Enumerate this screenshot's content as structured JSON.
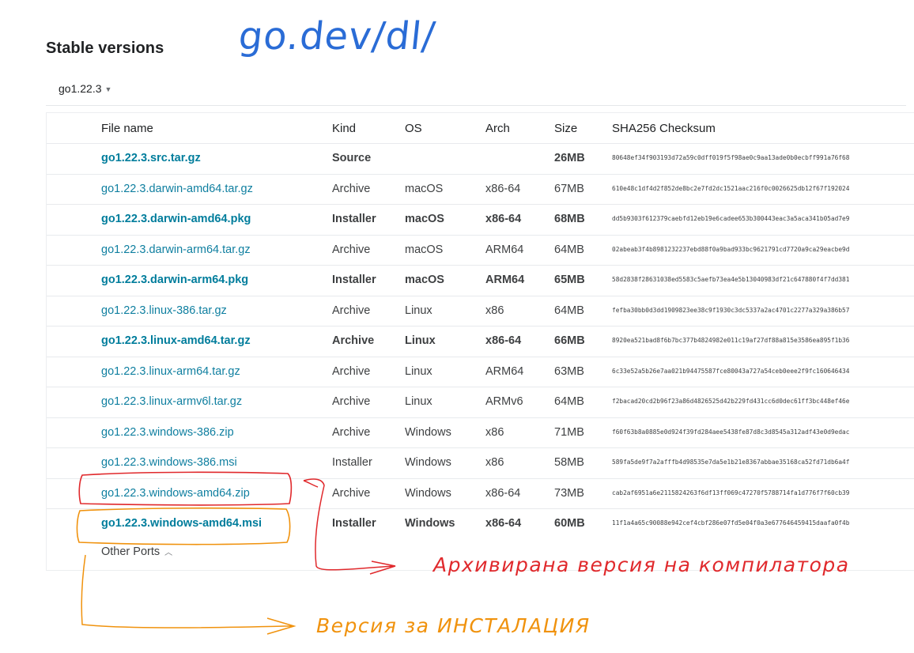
{
  "page": {
    "title": "Stable versions",
    "handwritten_url": "go.dev/dl/",
    "version_selected": "go1.22.3",
    "other_ports_label": "Other Ports"
  },
  "table": {
    "headers": {
      "file": "File name",
      "kind": "Kind",
      "os": "OS",
      "arch": "Arch",
      "size": "Size",
      "sha": "SHA256 Checksum"
    },
    "rows": [
      {
        "file": "go1.22.3.src.tar.gz",
        "kind": "Source",
        "os": "",
        "arch": "",
        "size": "26MB",
        "sha": "80648ef34f903193d72a59c0dff019f5f98ae0c9aa13ade0b0ecbff991a76f68",
        "bold": true
      },
      {
        "file": "go1.22.3.darwin-amd64.tar.gz",
        "kind": "Archive",
        "os": "macOS",
        "arch": "x86-64",
        "size": "67MB",
        "sha": "610e48c1df4d2f852de8bc2e7fd2dc1521aac216f0c0026625db12f67f192024",
        "bold": false
      },
      {
        "file": "go1.22.3.darwin-amd64.pkg",
        "kind": "Installer",
        "os": "macOS",
        "arch": "x86-64",
        "size": "68MB",
        "sha": "dd5b9303f612379caebfd12eb19e6cadee653b300443eac3a5aca341b05ad7e9",
        "bold": true
      },
      {
        "file": "go1.22.3.darwin-arm64.tar.gz",
        "kind": "Archive",
        "os": "macOS",
        "arch": "ARM64",
        "size": "64MB",
        "sha": "02abeab3f4b8981232237ebd88f0a9bad933bc9621791cd7720a9ca29eacbe9d",
        "bold": false
      },
      {
        "file": "go1.22.3.darwin-arm64.pkg",
        "kind": "Installer",
        "os": "macOS",
        "arch": "ARM64",
        "size": "65MB",
        "sha": "58d2838f28631038ed5583c5aefb73ea4e5b13040983df21c647880f4f7dd381",
        "bold": true
      },
      {
        "file": "go1.22.3.linux-386.tar.gz",
        "kind": "Archive",
        "os": "Linux",
        "arch": "x86",
        "size": "64MB",
        "sha": "fefba30bb0d3dd1909823ee38c9f1930c3dc5337a2ac4701c2277a329a386b57",
        "bold": false
      },
      {
        "file": "go1.22.3.linux-amd64.tar.gz",
        "kind": "Archive",
        "os": "Linux",
        "arch": "x86-64",
        "size": "66MB",
        "sha": "8920ea521bad8f6b7bc377b4824982e011c19af27df88a815e3586ea895f1b36",
        "bold": true
      },
      {
        "file": "go1.22.3.linux-arm64.tar.gz",
        "kind": "Archive",
        "os": "Linux",
        "arch": "ARM64",
        "size": "63MB",
        "sha": "6c33e52a5b26e7aa021b94475587fce80043a727a54ceb0eee2f9fc160646434",
        "bold": false
      },
      {
        "file": "go1.22.3.linux-armv6l.tar.gz",
        "kind": "Archive",
        "os": "Linux",
        "arch": "ARMv6",
        "size": "64MB",
        "sha": "f2bacad20cd2b96f23a86d4826525d42b229fd431cc6d0dec61ff3bc448ef46e",
        "bold": false
      },
      {
        "file": "go1.22.3.windows-386.zip",
        "kind": "Archive",
        "os": "Windows",
        "arch": "x86",
        "size": "71MB",
        "sha": "f60f63b8a0885e0d924f39fd284aee5438fe87d8c3d8545a312adf43e0d9edac",
        "bold": false
      },
      {
        "file": "go1.22.3.windows-386.msi",
        "kind": "Installer",
        "os": "Windows",
        "arch": "x86",
        "size": "58MB",
        "sha": "589fa5de9f7a2afffb4d98535e7da5e1b21e8367abbae35168ca52fd71db6a4f",
        "bold": false
      },
      {
        "file": "go1.22.3.windows-amd64.zip",
        "kind": "Archive",
        "os": "Windows",
        "arch": "x86-64",
        "size": "73MB",
        "sha": "cab2af6951a6e2115824263f6df13ff069c47270f5788714fa1d776f7f60cb39",
        "bold": false
      },
      {
        "file": "go1.22.3.windows-amd64.msi",
        "kind": "Installer",
        "os": "Windows",
        "arch": "x86-64",
        "size": "60MB",
        "sha": "11f1a4a65c90088e942cef4cbf286e07fd5e04f0a3e677646459415daafa0f4b",
        "bold": true
      }
    ]
  },
  "annotations": {
    "archive_note": "Архивирана версия на компилатора",
    "installer_note": "Версия за ИНСТАЛАЦИЯ",
    "archive_color": "#e0292c",
    "installer_color": "#f0920d",
    "url_color": "#2a6cd6"
  }
}
